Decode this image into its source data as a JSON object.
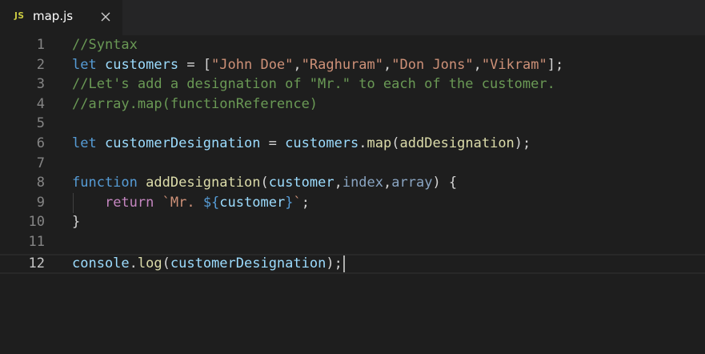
{
  "tab": {
    "icon_text": "JS",
    "title": "map.js"
  },
  "editor": {
    "line_numbers": [
      "1",
      "2",
      "3",
      "4",
      "5",
      "6",
      "7",
      "8",
      "9",
      "10",
      "11",
      "12"
    ],
    "l1": {
      "comment": "//Syntax"
    },
    "l2": {
      "kw": "let",
      "sp1": " ",
      "var": "customers",
      "eq": " = [",
      "s1": "\"John Doe\"",
      "c1": ",",
      "s2": "\"Raghuram\"",
      "c2": ",",
      "s3": "\"Don Jons\"",
      "c3": ",",
      "s4": "\"Vikram\"",
      "end": "];"
    },
    "l3": {
      "comment": "//Let's add a designation of \"Mr.\" to each of the customer."
    },
    "l4": {
      "comment": "//array.map(functionReference)"
    },
    "l6": {
      "kw": "let",
      "sp1": " ",
      "var": "customerDesignation",
      "eq": " = ",
      "obj": "customers",
      "dot": ".",
      "method": "map",
      "open": "(",
      "arg": "addDesignation",
      "close": ");"
    },
    "l8": {
      "kw": "function",
      "sp1": " ",
      "fname": "addDesignation",
      "open": "(",
      "p1": "customer",
      "c1": ",",
      "p2": "index",
      "c2": ",",
      "p3": "array",
      "close": ") {"
    },
    "l9": {
      "indent": "    ",
      "kw": "return",
      "sp1": " ",
      "str1": "`Mr. ",
      "interp_open": "${",
      "interp_var": "customer",
      "interp_close": "}",
      "str2": "`",
      "semi": ";"
    },
    "l10": {
      "brace": "}"
    },
    "l12": {
      "obj": "console",
      "dot": ".",
      "method": "log",
      "open": "(",
      "arg": "customerDesignation",
      "close": ");"
    }
  },
  "colors": {
    "background": "#1e1e1e",
    "tabbar": "#252526",
    "comment": "#6a9955",
    "keyword": "#569cd6",
    "control": "#c586c0",
    "variable": "#9cdcfe",
    "function": "#dcdcaa",
    "string": "#ce9178",
    "js_icon": "#cbcb41"
  }
}
